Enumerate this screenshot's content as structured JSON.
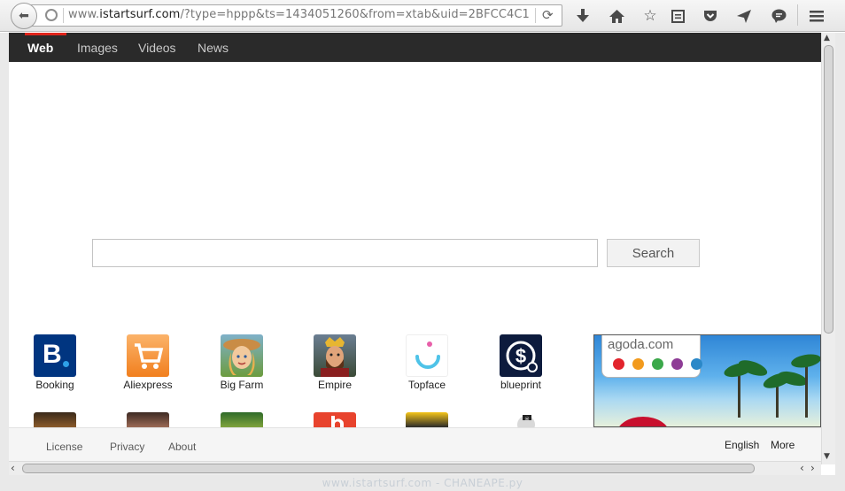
{
  "browser": {
    "url_prefix": "www.",
    "url_domain": "istartsurf.com",
    "url_rest": "/?type=hppp&ts=1434051260&from=xtab&uid=2BFCC4C1"
  },
  "nav": {
    "items": [
      {
        "label": "Web",
        "active": true
      },
      {
        "label": "Images"
      },
      {
        "label": "Videos"
      },
      {
        "label": "News"
      }
    ]
  },
  "search": {
    "value": "",
    "placeholder": "",
    "button_label": "Search"
  },
  "tiles": [
    {
      "label": "Booking",
      "icon": "booking-icon",
      "color": "#003580"
    },
    {
      "label": "Aliexpress",
      "icon": "aliexpress-icon",
      "color": "#f57d22"
    },
    {
      "label": "Big Farm",
      "icon": "big-farm-icon",
      "color": "#c9a35a"
    },
    {
      "label": "Empire",
      "icon": "empire-icon",
      "color": "#8a3b2a"
    },
    {
      "label": "Topface",
      "icon": "topface-icon",
      "color": "#4fc3e8"
    },
    {
      "label": "blueprint",
      "icon": "blueprint-icon",
      "color": "#0d1b3d"
    }
  ],
  "ad": {
    "brand": "agoda.com",
    "dot_colors": [
      "#e2242c",
      "#f29a1d",
      "#3ba84a",
      "#8e3c96",
      "#2b88c8"
    ]
  },
  "footer": {
    "links": [
      "License",
      "Privacy",
      "About"
    ],
    "language": "English",
    "more": "More"
  },
  "watermark": "www.istartsurf.com - CHANEAPE.py"
}
